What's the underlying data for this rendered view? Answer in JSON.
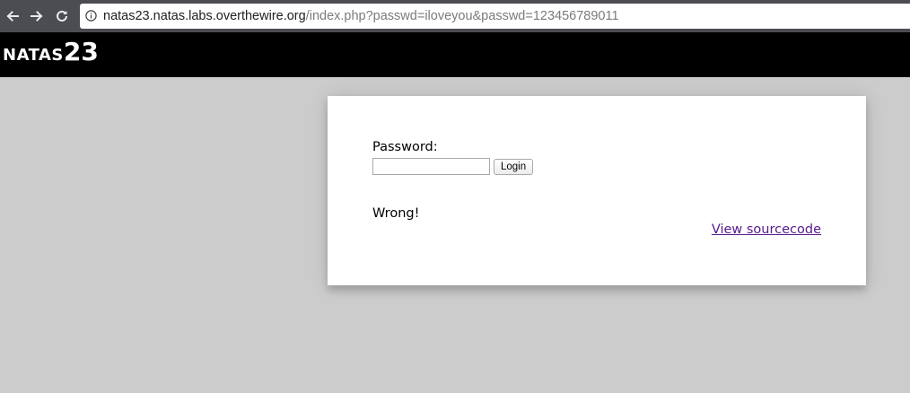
{
  "browser": {
    "url_host": "natas23.natas.labs.overthewire.org",
    "url_rest": "/index.php?passwd=iloveyou&passwd=123456789011",
    "icons": {
      "back": "back-arrow-icon",
      "forward": "forward-arrow-icon",
      "reload": "reload-icon",
      "site_info": "info-icon"
    }
  },
  "header": {
    "title_name": "NATAS",
    "title_number": "23"
  },
  "form": {
    "password_label": "Password:",
    "password_value": "",
    "login_label": "Login"
  },
  "result": {
    "message": "Wrong!"
  },
  "links": {
    "view_source": "View sourcecode"
  },
  "colors": {
    "page_background": "#cccccc",
    "header_background": "#000000",
    "link_visited": "#551a8b"
  }
}
